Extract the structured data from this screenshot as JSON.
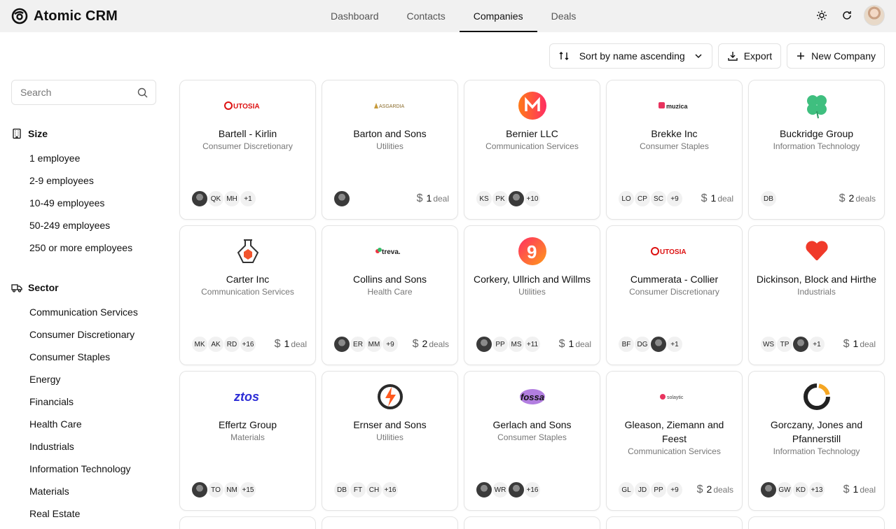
{
  "app": {
    "name": "Atomic CRM"
  },
  "nav": {
    "tabs": [
      "Dashboard",
      "Contacts",
      "Companies",
      "Deals"
    ],
    "active": "Companies"
  },
  "toolbar": {
    "sort_label": "Sort by name ascending",
    "export_label": "Export",
    "new_label": "New Company"
  },
  "search": {
    "placeholder": "Search"
  },
  "filters": {
    "size": {
      "title": "Size",
      "items": [
        "1 employee",
        "2-9 employees",
        "10-49 employees",
        "50-249 employees",
        "250 or more employees"
      ]
    },
    "sector": {
      "title": "Sector",
      "items": [
        "Communication Services",
        "Consumer Discretionary",
        "Consumer Staples",
        "Energy",
        "Financials",
        "Health Care",
        "Industrials",
        "Information Technology",
        "Materials",
        "Real Estate"
      ]
    }
  },
  "companies": [
    {
      "name": "Bartell - Kirlin",
      "sector": "Consumer Discretionary",
      "logo": "UTOSIA",
      "contacts": [
        "photo",
        "QK",
        "MH"
      ],
      "more": "+1",
      "deals_count": "",
      "deals_word": ""
    },
    {
      "name": "Barton and Sons",
      "sector": "Utilities",
      "logo": "ASGARDIA",
      "contacts": [
        "photo"
      ],
      "more": "",
      "deals_count": "1",
      "deals_word": "deal"
    },
    {
      "name": "Bernier LLC",
      "sector": "Communication Services",
      "logo": "M",
      "contacts": [
        "KS",
        "PK",
        "photo"
      ],
      "more": "+10",
      "deals_count": "",
      "deals_word": ""
    },
    {
      "name": "Brekke Inc",
      "sector": "Consumer Staples",
      "logo": "muzica",
      "contacts": [
        "LO",
        "CP",
        "SC"
      ],
      "more": "+9",
      "deals_count": "1",
      "deals_word": "deal"
    },
    {
      "name": "Buckridge Group",
      "sector": "Information Technology",
      "logo": "clover",
      "contacts": [
        "DB"
      ],
      "more": "",
      "deals_count": "2",
      "deals_word": "deals"
    },
    {
      "name": "Carter Inc",
      "sector": "Communication Services",
      "logo": "flask",
      "contacts": [
        "MK",
        "AK",
        "RD"
      ],
      "more": "+16",
      "deals_count": "1",
      "deals_word": "deal"
    },
    {
      "name": "Collins and Sons",
      "sector": "Health Care",
      "logo": "treva.",
      "contacts": [
        "photo",
        "ER",
        "MM"
      ],
      "more": "+9",
      "deals_count": "2",
      "deals_word": "deals"
    },
    {
      "name": "Corkery, Ullrich and Willms",
      "sector": "Utilities",
      "logo": "9",
      "contacts": [
        "photo",
        "PP",
        "MS"
      ],
      "more": "+11",
      "deals_count": "1",
      "deals_word": "deal"
    },
    {
      "name": "Cummerata - Collier",
      "sector": "Consumer Discretionary",
      "logo": "UTOSIA",
      "contacts": [
        "BF",
        "DG",
        "photo"
      ],
      "more": "+1",
      "deals_count": "",
      "deals_word": ""
    },
    {
      "name": "Dickinson, Block and Hirthe",
      "sector": "Industrials",
      "logo": "heart",
      "contacts": [
        "WS",
        "TP",
        "photo"
      ],
      "more": "+1",
      "deals_count": "1",
      "deals_word": "deal"
    },
    {
      "name": "Effertz Group",
      "sector": "Materials",
      "logo": "ztos",
      "contacts": [
        "photo",
        "TO",
        "NM"
      ],
      "more": "+15",
      "deals_count": "",
      "deals_word": ""
    },
    {
      "name": "Ernser and Sons",
      "sector": "Utilities",
      "logo": "bolt",
      "contacts": [
        "DB",
        "FT",
        "CH"
      ],
      "more": "+16",
      "deals_count": "",
      "deals_word": ""
    },
    {
      "name": "Gerlach and Sons",
      "sector": "Consumer Staples",
      "logo": "fossa",
      "contacts": [
        "photo",
        "WR",
        "photo"
      ],
      "more": "+16",
      "deals_count": "",
      "deals_word": ""
    },
    {
      "name": "Gleason, Ziemann and Feest",
      "sector": "Communication Services",
      "logo": "solaytic",
      "contacts": [
        "GL",
        "JD",
        "PP"
      ],
      "more": "+9",
      "deals_count": "2",
      "deals_word": "deals"
    },
    {
      "name": "Gorczany, Jones and Pfannerstill",
      "sector": "Information Technology",
      "logo": "ring",
      "contacts": [
        "photo",
        "GW",
        "KD"
      ],
      "more": "+13",
      "deals_count": "1",
      "deals_word": "deal"
    }
  ],
  "colors": {
    "accent": "#111111",
    "muted": "#777777",
    "topbar_bg": "#f1f1f1",
    "border": "#e4e4e4"
  }
}
